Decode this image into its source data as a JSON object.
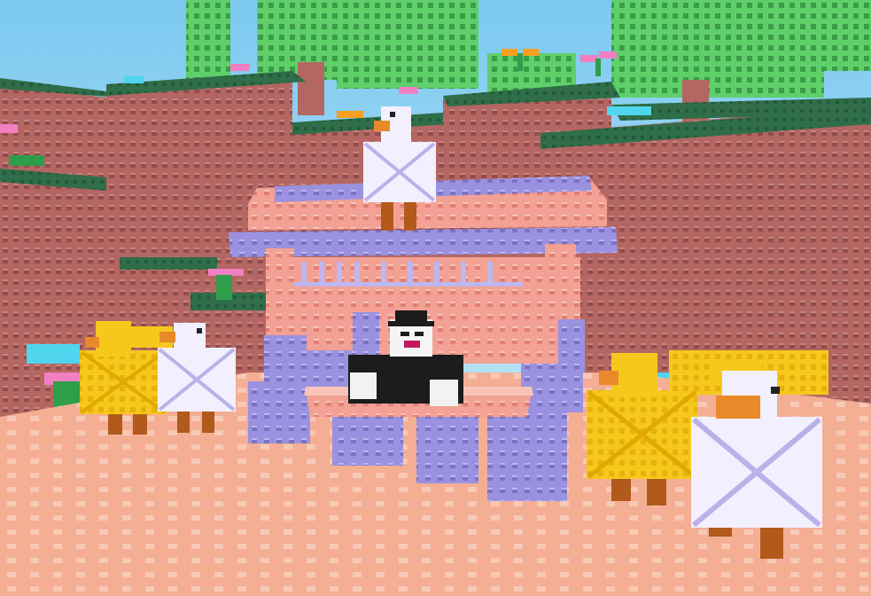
{
  "scene": {
    "description_label": "",
    "palette": {
      "sky_top": "#7cc9f0",
      "sky_bottom": "#c9ecf8",
      "cliff_red": "#b46662",
      "cliff_dark": "#8e4c4a",
      "grass_green": "#2f6e49",
      "tree_green": "#5fcf6a",
      "tree_green_dark": "#3fa54d",
      "floor_peach": "#f5b39a",
      "floor_stud": "#f3c8b4",
      "stand_pink": "#f29c91",
      "stand_lavender": "#9a92e0",
      "duck_white": "#f2efff",
      "duck_yellow": "#f6c81c",
      "duck_orange": "#e8892a",
      "duck_leg": "#b25a1c",
      "avatar_black": "#1c1c1c",
      "flower_pink": "#f27fc1",
      "flower_cyan": "#4fd6ee",
      "flower_orange": "#f5a020"
    },
    "objects": [
      {
        "name": "white-duck-on-roof"
      },
      {
        "name": "white-duck-left"
      },
      {
        "name": "yellow-duck-left"
      },
      {
        "name": "yellow-duck-right"
      },
      {
        "name": "white-duck-right"
      },
      {
        "name": "yellow-duck-back-right"
      },
      {
        "name": "shopkeeper-avatar"
      },
      {
        "name": "market-stand"
      },
      {
        "name": "block-cliff-left"
      },
      {
        "name": "block-cliff-right"
      },
      {
        "name": "voxel-tree"
      }
    ]
  }
}
